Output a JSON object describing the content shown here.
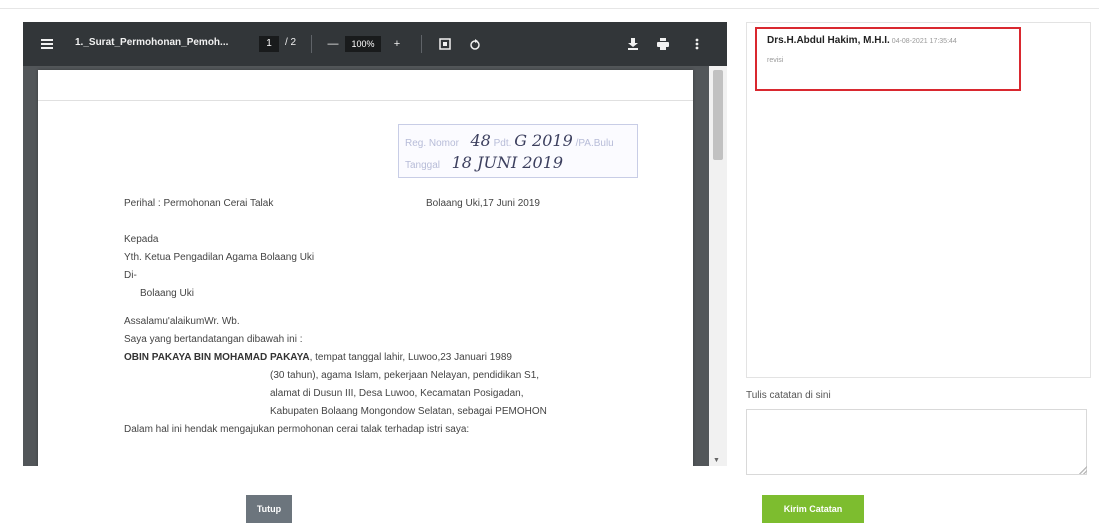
{
  "viewer": {
    "file_title": "1._Surat_Permohonan_Pemoh...",
    "page_current": "1",
    "page_total": "/ 2",
    "zoom": "100%",
    "zoom_minus": "—",
    "zoom_plus": "+",
    "icons": [
      "menu-icon",
      "fit-page-icon",
      "rotate-icon",
      "download-icon",
      "print-icon",
      "more-icon"
    ]
  },
  "document": {
    "reg_no_label": "Reg. Nomor",
    "reg_no_value": "48",
    "reg_no_mid": "Pdt.",
    "reg_no_value2": "G 2019",
    "reg_no_suffix": "/PA.Bulu",
    "reg_date_label": "Tanggal",
    "reg_date_value": "18 JUNI 2019",
    "subject": "Perihal : Permohonan Cerai Talak",
    "place_date": "Bolaang Uki,17 Juni 2019",
    "to": "Kepada",
    "addressee": "Yth. Ketua Pengadilan Agama Bolaang Uki",
    "at": "Di-",
    "city": "Bolaang Uki",
    "greeting": "Assalamu'alaikumWr. Wb.",
    "intro": "Saya yang bertandatangan dibawah ini :",
    "name": "OBIN PAKAYA BIN MOHAMAD PAKAYA",
    "details_1": ", tempat tanggal lahir, Luwoo,23 Januari 1989",
    "details_2": "(30 tahun), agama Islam, pekerjaan Nelayan, pendidikan S1,",
    "details_3": "alamat di Dusun III, Desa Luwoo, Kecamatan Posigadan,",
    "details_4": "Kabupaten Bolaang Mongondow Selatan, sebagai PEMOHON",
    "closing_line": "Dalam hal ini hendak mengajukan permohonan cerai talak terhadap istri saya:"
  },
  "notes": {
    "entries": [
      {
        "author": "Drs.H.Abdul Hakim, M.H.I.",
        "date": "04-08-2021 17:35:44",
        "text": "revisi"
      }
    ],
    "input_label": "Tulis catatan di sini",
    "input_value": ""
  },
  "buttons": {
    "close": "Tutup",
    "send": "Kirim Catatan"
  },
  "colors": {
    "toolbar": "#323639",
    "viewer_bg": "#525659",
    "note_highlight": "#d9282f",
    "close_button": "#6c757d",
    "send_button": "#7dbd2f"
  }
}
